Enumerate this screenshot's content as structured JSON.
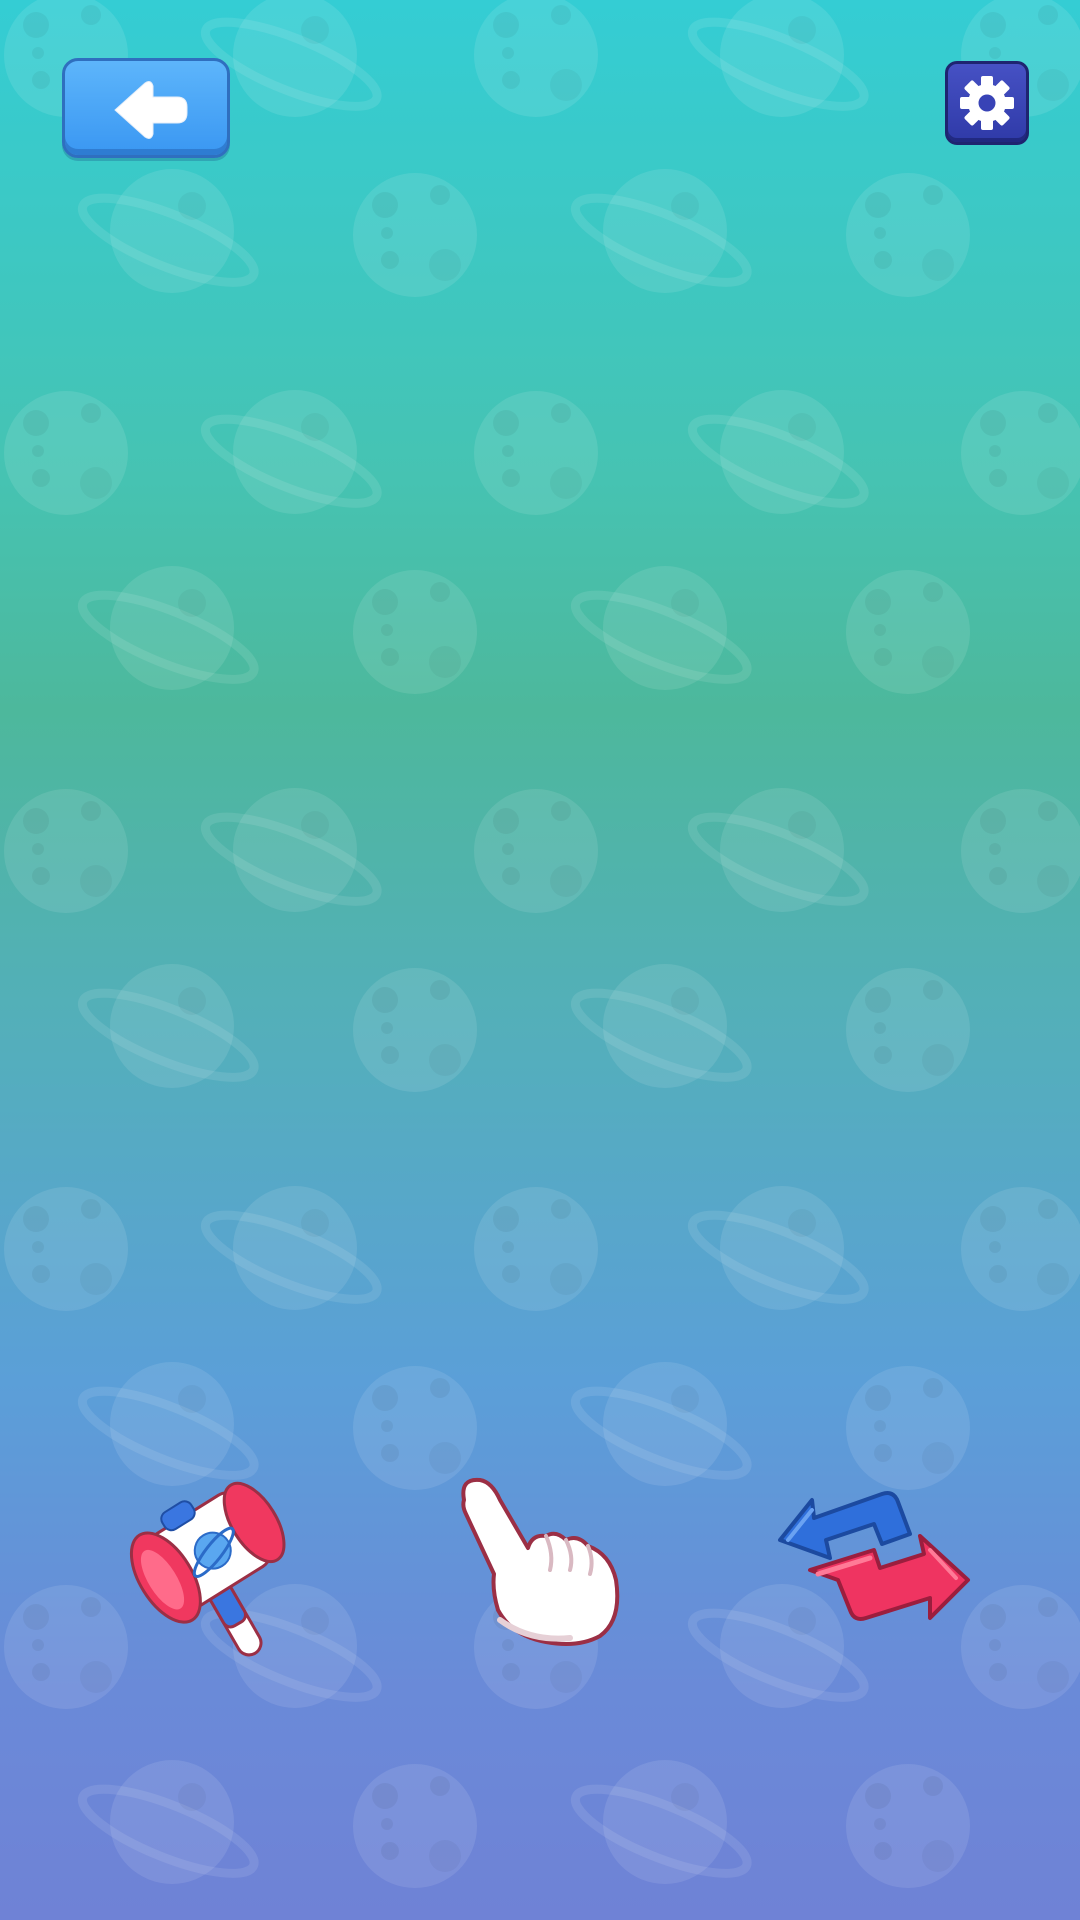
{
  "screen": {
    "background_colors": [
      "#34cdd4",
      "#4db89c",
      "#5b9fd8",
      "#6f82d6"
    ],
    "pattern_icons": [
      "planet-ringed-icon",
      "moon-cratered-icon"
    ]
  },
  "header": {
    "back_button": {
      "icon": "arrow-left-icon",
      "color": "#3a97f2"
    },
    "settings_button": {
      "icon": "gear-icon",
      "color": "#3843b6"
    }
  },
  "tools": [
    {
      "id": "hammer",
      "icon": "hammer-icon",
      "colors": [
        "#f0385f",
        "#ffffff",
        "#3a76e0"
      ]
    },
    {
      "id": "tap",
      "icon": "pointing-hand-icon",
      "colors": [
        "#ffffff",
        "#9b2f45"
      ]
    },
    {
      "id": "swap",
      "icon": "swap-arrows-icon",
      "colors": [
        "#2f6fdb",
        "#ef3461"
      ]
    }
  ]
}
